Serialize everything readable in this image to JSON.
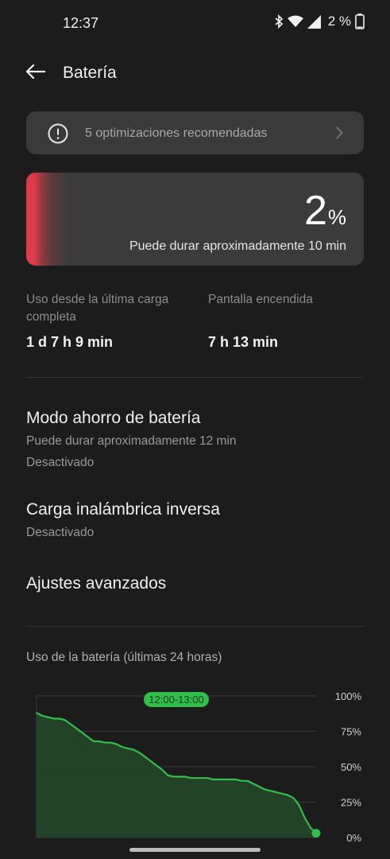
{
  "status_bar": {
    "time": "12:37",
    "battery_text": "2 %",
    "icons": [
      "bluetooth-icon",
      "wifi-icon",
      "cell-signal-icon",
      "battery-icon"
    ]
  },
  "header": {
    "title": "Batería",
    "back_icon": "arrow-left-icon"
  },
  "optimizations": {
    "text": "5 optimizaciones recomendadas",
    "icon": "info-icon"
  },
  "battery": {
    "level_percent": 2,
    "percent": "2",
    "percent_symbol": "%",
    "estimate": "Puede durar aproximadamente 10 min",
    "accent": "#e23b47"
  },
  "stats": {
    "since_charge_label": "Uso desde la última carga completa",
    "since_charge_value": "1 d 7 h 9 min",
    "screen_on_label": "Pantalla encendida",
    "screen_on_value": "7 h 13 min"
  },
  "settings": {
    "saver": {
      "title": "Modo ahorro de batería",
      "subtitle": "Puede durar aproximadamente 12 min",
      "status": "Desactivado"
    },
    "reverse": {
      "title": "Carga inalámbrica inversa",
      "status": "Desactivado"
    },
    "advanced": {
      "title": "Ajustes avanzados"
    }
  },
  "chart_title": "Uso de la batería (últimas 24 horas)",
  "chart_data": {
    "type": "area",
    "title": "",
    "y_ticks": [
      "100%",
      "75%",
      "50%",
      "25%",
      "0%"
    ],
    "ylim": [
      0,
      100
    ],
    "highlight_label": "12:00-13:00",
    "series_color": "#2fbf4a",
    "values": [
      88,
      86,
      85,
      84,
      84,
      83,
      80,
      77,
      74,
      71,
      68,
      68,
      67,
      67,
      66,
      64,
      63,
      62,
      60,
      57,
      54,
      51,
      48,
      44,
      43,
      43,
      43,
      42,
      42,
      42,
      42,
      41,
      41,
      41,
      41,
      41,
      40,
      40,
      38,
      36,
      34,
      33,
      32,
      31,
      30,
      28,
      23,
      14,
      7,
      3
    ]
  }
}
